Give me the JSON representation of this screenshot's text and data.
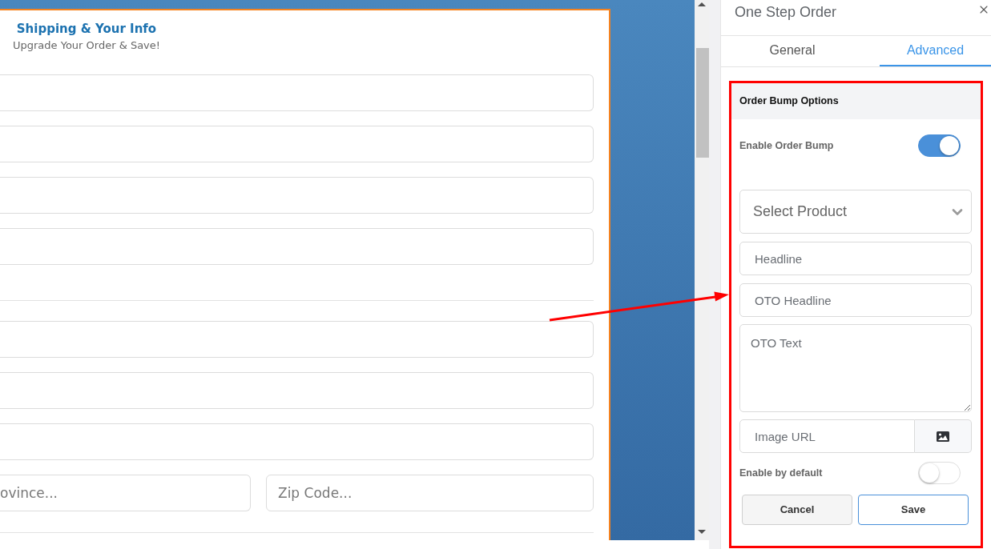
{
  "builder": {
    "header": {
      "title": "Shipping & Your Info",
      "subtitle": "Upgrade Your Order & Save!"
    },
    "form_rows": [
      {
        "kind": "input"
      },
      {
        "kind": "input"
      },
      {
        "kind": "input"
      },
      {
        "kind": "input"
      },
      {
        "kind": "divider"
      },
      {
        "kind": "input"
      },
      {
        "kind": "input"
      },
      {
        "kind": "input"
      },
      {
        "kind": "pair",
        "fields": [
          {
            "placeholder": "ovince..."
          },
          {
            "placeholder": "Zip Code..."
          }
        ]
      },
      {
        "kind": "divider"
      }
    ]
  },
  "panel": {
    "title": "One Step Order",
    "tabs": [
      {
        "label": "General",
        "selected": false
      },
      {
        "label": "Advanced",
        "selected": true
      }
    ],
    "section": {
      "title": "Order Bump Options",
      "controls": [
        {
          "kind": "toggle",
          "label": "Enable Order Bump",
          "on": true
        },
        {
          "kind": "select",
          "placeholder": "Select Product"
        },
        {
          "kind": "input",
          "placeholder": "Headline"
        },
        {
          "kind": "input",
          "placeholder": "OTO Headline"
        },
        {
          "kind": "textarea",
          "placeholder": "OTO Text"
        },
        {
          "kind": "image_input",
          "placeholder": "Image URL"
        },
        {
          "kind": "toggle",
          "label": "Enable by default",
          "on": false
        }
      ],
      "buttons": [
        {
          "kind": "secondary",
          "label": "Cancel"
        },
        {
          "kind": "primary",
          "label": "Save"
        }
      ]
    }
  }
}
